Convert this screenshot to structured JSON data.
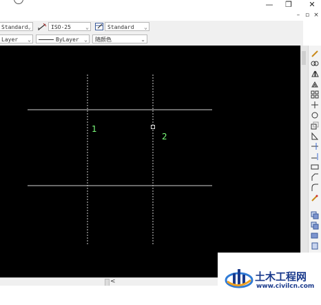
{
  "window": {
    "minimize": "—",
    "restore": "❐",
    "close": "✕",
    "doc_minimize": "–",
    "doc_restore": "▫",
    "doc_close": "×"
  },
  "toolbar1": {
    "text_style": "Standard",
    "dim_style": "ISO-25",
    "table_style": "Standard"
  },
  "toolbar2": {
    "layer": "Layer",
    "linetype": "ByLayer",
    "color": "随颜色"
  },
  "drawing": {
    "label_1": "1",
    "label_2": "2"
  },
  "scrollbar": {
    "left_arrow": "<"
  },
  "watermark": {
    "title": "土木工程网",
    "url": "www.civilcn.com"
  },
  "colors": {
    "canvas": "#000000",
    "solid_line": "#8c8c8c",
    "dashed_line": "#cfcfcf",
    "label": "#7cff7c",
    "brand": "#1a3a8c"
  },
  "icons": [
    "pencil-icon",
    "eraser-icon",
    "mirror-icon",
    "offset-icon",
    "array-icon",
    "move-icon",
    "rotate-icon",
    "scale-icon",
    "stretch-icon",
    "trim-icon",
    "extend-icon",
    "break-icon",
    "chamfer-icon",
    "fillet-icon",
    "explode-icon",
    "copy-icon",
    "paste-icon",
    "layer-icon"
  ]
}
